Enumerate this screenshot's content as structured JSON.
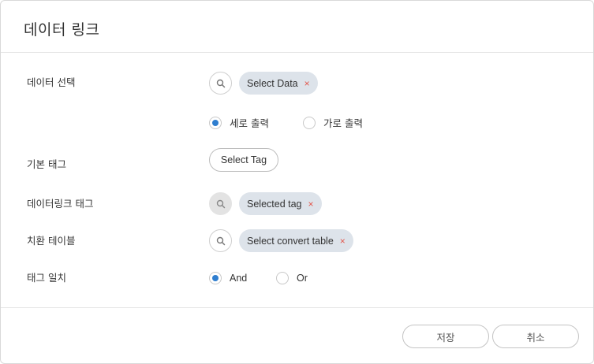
{
  "dialog": {
    "title": "데이터 링크"
  },
  "rows": {
    "data_select": {
      "label": "데이터 선택",
      "chip": "Select Data",
      "chip_remove": "×"
    },
    "output": {
      "options": [
        "세로 출력",
        "가로 출력"
      ],
      "selected": "세로 출력"
    },
    "base_tag": {
      "label": "기본 태그",
      "button": "Select Tag"
    },
    "datalink_tag": {
      "label": "데이터링크 태그",
      "chip": "Selected tag",
      "chip_remove": "×"
    },
    "convert_table": {
      "label": "치환 테이블",
      "chip": "Select convert table",
      "chip_remove": "×"
    },
    "tag_match": {
      "label": "태그 일치",
      "options": [
        "And",
        "Or"
      ],
      "selected": "And"
    }
  },
  "footer": {
    "save_label": "저장",
    "cancel_label": "취소"
  },
  "colors": {
    "accent": "#2f7ecf",
    "chip_bg": "#dde3ea",
    "remove_x": "#e2574c"
  },
  "icons": {
    "search": "search-icon"
  }
}
